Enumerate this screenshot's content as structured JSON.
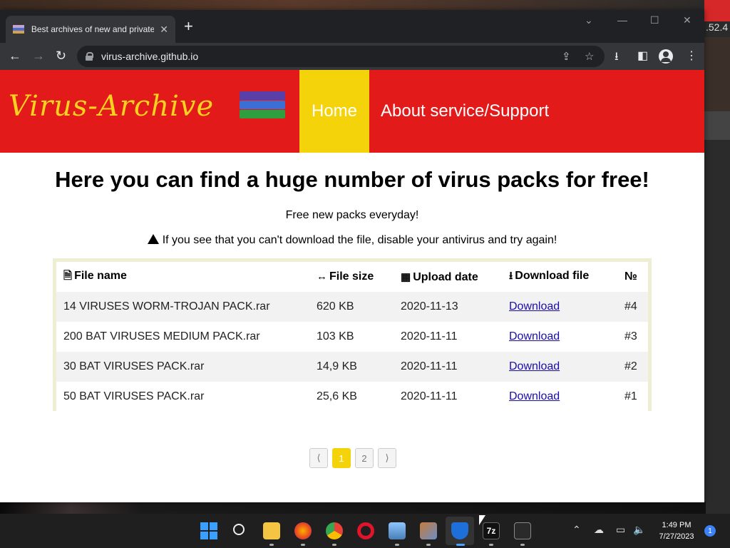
{
  "colors": {
    "header_red": "#e21a1a",
    "logo_yellow": "#f7d21e",
    "home_yellow": "#f5d30a",
    "link_blue": "#1a0dab"
  },
  "desktop": {
    "corner_text": ".52.4"
  },
  "browser": {
    "tab_title": "Best archives of new and private",
    "tab_close": "✕",
    "new_tab": "+",
    "url": "virus-archive.github.io"
  },
  "site": {
    "logo_text": "Virus-Archive",
    "nav": {
      "home": "Home",
      "about": "About service/Support"
    },
    "headline": "Here you can find a huge number of virus packs for free!",
    "subtitle": "Free new packs everyday!",
    "warning": "If you see that you can't download the file, disable your antivirus and try again!",
    "table": {
      "headers": {
        "name": "File name",
        "size": "File size",
        "date": "Upload date",
        "download": "Download file",
        "num": "№"
      },
      "rows": [
        {
          "name": "14 VIRUSES WORM-TROJAN PACK.rar",
          "size": "620 KB",
          "date": "2020-11-13",
          "link": "Download",
          "num": "#4"
        },
        {
          "name": "200 BAT VIRUSES MEDIUM PACK.rar",
          "size": "103 KB",
          "date": "2020-11-11",
          "link": "Download",
          "num": "#3"
        },
        {
          "name": "30 BAT VIRUSES PACK.rar",
          "size": "14,9 KB",
          "date": "2020-11-11",
          "link": "Download",
          "num": "#2"
        },
        {
          "name": "50 BAT VIRUSES PACK.rar",
          "size": "25,6 KB",
          "date": "2020-11-11",
          "link": "Download",
          "num": "#1"
        }
      ]
    },
    "pagination": {
      "prev": "⟨",
      "pages": [
        "1",
        "2"
      ],
      "next": "⟩",
      "current": "1"
    }
  },
  "taskbar": {
    "icons": [
      "windows-start-icon",
      "search-icon",
      "file-explorer-icon",
      "firefox-icon",
      "chrome-icon",
      "opera-icon",
      "photos-icon",
      "game-icon",
      "defender-icon",
      "7zip-icon",
      "terminal-icon"
    ],
    "zip_label": "7z",
    "time": "1:49 PM",
    "date": "7/27/2023",
    "notification_count": "1"
  }
}
